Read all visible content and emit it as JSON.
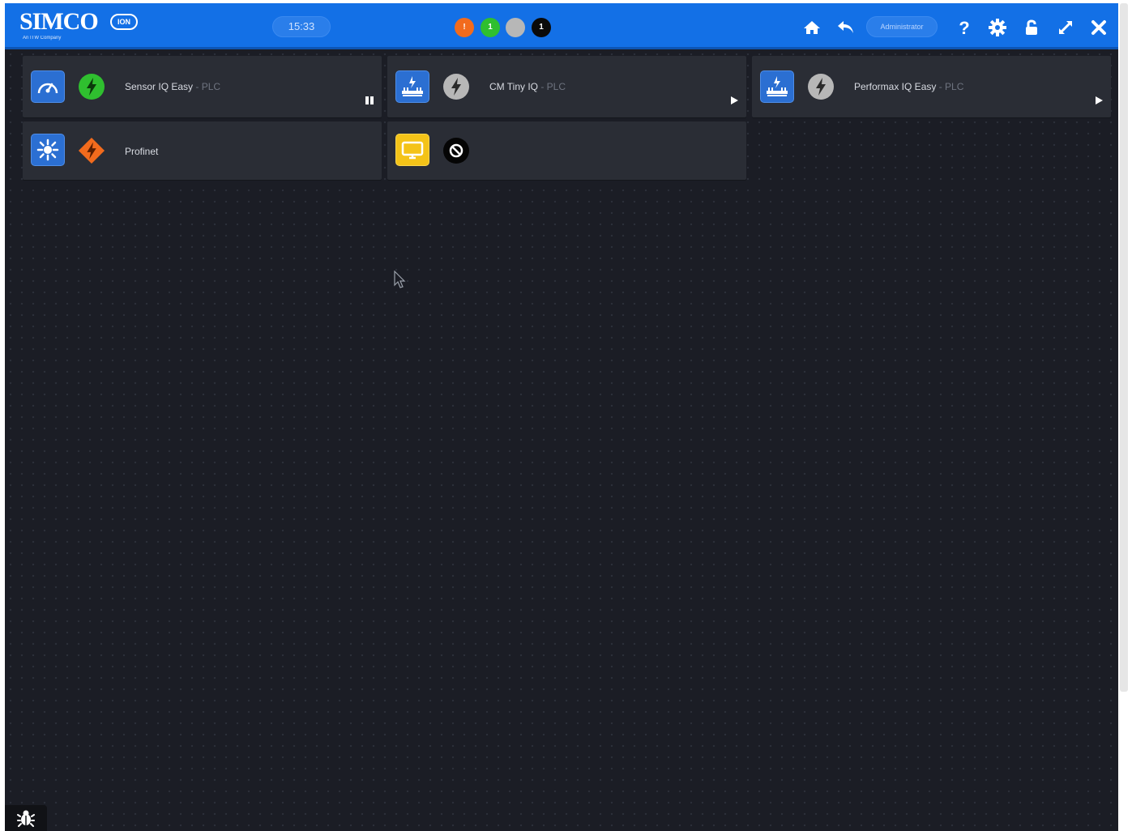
{
  "header": {
    "logo_text": "SIMCO",
    "logo_badge": "ION",
    "logo_subtitle": "An ITW Company",
    "clock": "15:33",
    "status_dots": [
      {
        "name": "alarm-status-dot",
        "label": "!",
        "color": "#f26b1d"
      },
      {
        "name": "ok-status-dot",
        "label": "1",
        "color": "#2fbf2f"
      },
      {
        "name": "idle-status-dot",
        "label": "",
        "color": "#b7b7b7"
      },
      {
        "name": "off-status-dot",
        "label": "1",
        "color": "#0a0a0a"
      }
    ],
    "user_label": "Administrator",
    "icons": [
      "home-icon",
      "back-icon",
      "help-icon",
      "settings-icon",
      "unlock-icon",
      "fullscreen-icon",
      "close-icon"
    ]
  },
  "tiles": [
    {
      "name": "sensor-iq-easy",
      "title": "Sensor IQ Easy",
      "subtitle": " - PLC",
      "icon": "gauge-icon",
      "status": "green-active",
      "action": "pause-icon"
    },
    {
      "name": "cm-tiny-iq",
      "title": "CM Tiny IQ",
      "subtitle": " - PLC",
      "icon": "charging-bar-icon",
      "status": "grey-inactive",
      "action": "play-icon"
    },
    {
      "name": "performax-iq-easy",
      "title": "Performax IQ Easy",
      "subtitle": " - PLC",
      "icon": "charging-bar-icon",
      "status": "grey-inactive",
      "action": "play-icon"
    },
    {
      "name": "profinet",
      "title": "Profinet",
      "subtitle": "",
      "icon": "network-icon",
      "status": "orange-warning",
      "action": ""
    },
    {
      "name": "display",
      "title": "",
      "subtitle": "",
      "icon": "screen-icon",
      "status": "black-disabled",
      "action": ""
    }
  ],
  "colors": {
    "header": "#1370e6",
    "background": "#1b1d25",
    "tile": "#2a2d35",
    "ok": "#2fbf2f",
    "warning": "#f26b1d",
    "inactive": "#b7b7b7"
  }
}
